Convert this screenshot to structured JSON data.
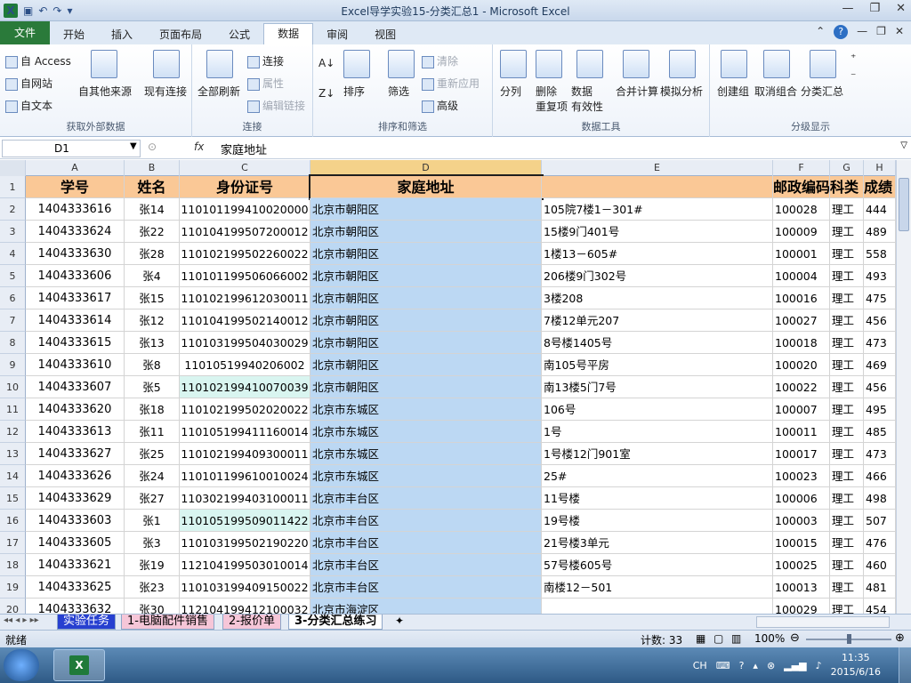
{
  "window": {
    "title": "Excel导学实验15-分类汇总1 - Microsoft Excel",
    "qat_icons": [
      "excel-icon",
      "save-icon",
      "undo-icon",
      "redo-icon",
      "customize-icon"
    ]
  },
  "ribbon": {
    "file_tab": "文件",
    "tabs": [
      "开始",
      "插入",
      "页面布局",
      "公式",
      "数据",
      "审阅",
      "视图"
    ],
    "active_tab": "数据",
    "groups": {
      "external": {
        "label": "获取外部数据",
        "access": "自 Access",
        "web": "自网站",
        "text": "自文本",
        "other": "自其他来源",
        "existing": "现有连接"
      },
      "connections": {
        "label": "连接",
        "refresh_all": "全部刷新",
        "connections": "连接",
        "properties": "属性",
        "edit_links": "编辑链接"
      },
      "sort_filter": {
        "label": "排序和筛选",
        "sort": "排序",
        "filter": "筛选",
        "clear": "清除",
        "reapply": "重新应用",
        "advanced": "高级"
      },
      "data_tools": {
        "label": "数据工具",
        "split": "分列",
        "remove_dup_1": "删除",
        "remove_dup_2": "重复项",
        "validation_1": "数据",
        "validation_2": "有效性",
        "consolidate": "合并计算",
        "whatif": "模拟分析"
      },
      "outline": {
        "label": "分级显示",
        "group": "创建组",
        "ungroup": "取消组合",
        "subtotal": "分类汇总"
      }
    }
  },
  "formula_bar": {
    "name_box": "D1",
    "fx": "fx",
    "content": "家庭地址"
  },
  "sheet": {
    "columns": [
      "A",
      "B",
      "C",
      "D",
      "E",
      "F",
      "G",
      "H"
    ],
    "headers": {
      "A": "学号",
      "B": "姓名",
      "C": "身份证号",
      "D": "家庭地址",
      "E": "",
      "F": "邮政编码",
      "G": "科类",
      "H": "成绩"
    },
    "rows": [
      {
        "n": "2",
        "a": "1404333616",
        "b": "张14",
        "c": "110101199410020000",
        "d": "北京市朝阳区",
        "e": "105院7楼1－301#",
        "f": "100028",
        "g": "理工",
        "h": "444"
      },
      {
        "n": "3",
        "a": "1404333624",
        "b": "张22",
        "c": "110104199507200012",
        "d": "北京市朝阳区",
        "e": "15楼9门401号",
        "f": "100009",
        "g": "理工",
        "h": "489"
      },
      {
        "n": "4",
        "a": "1404333630",
        "b": "张28",
        "c": "110102199502260022",
        "d": "北京市朝阳区",
        "e": "1楼13－605#",
        "f": "100001",
        "g": "理工",
        "h": "558"
      },
      {
        "n": "5",
        "a": "1404333606",
        "b": "张4",
        "c": "110101199506066002",
        "d": "北京市朝阳区",
        "e": "206楼9门302号",
        "f": "100004",
        "g": "理工",
        "h": "493"
      },
      {
        "n": "6",
        "a": "1404333617",
        "b": "张15",
        "c": "110102199612030011",
        "d": "北京市朝阳区",
        "e": "3楼208",
        "f": "100016",
        "g": "理工",
        "h": "475"
      },
      {
        "n": "7",
        "a": "1404333614",
        "b": "张12",
        "c": "110104199502140012",
        "d": "北京市朝阳区",
        "e": "7楼12单元207",
        "f": "100027",
        "g": "理工",
        "h": "456"
      },
      {
        "n": "8",
        "a": "1404333615",
        "b": "张13",
        "c": "110103199504030029",
        "d": "北京市朝阳区",
        "e": "8号楼1405号",
        "f": "100018",
        "g": "理工",
        "h": "473"
      },
      {
        "n": "9",
        "a": "1404333610",
        "b": "张8",
        "c": "11010519940206002",
        "d": "北京市朝阳区",
        "e": "南105号平房",
        "f": "100020",
        "g": "理工",
        "h": "469"
      },
      {
        "n": "10",
        "a": "1404333607",
        "b": "张5",
        "c": "110102199410070039",
        "d": "北京市朝阳区",
        "e": "南13楼5门7号",
        "f": "100022",
        "g": "理工",
        "h": "456"
      },
      {
        "n": "11",
        "a": "1404333620",
        "b": "张18",
        "c": "110102199502020022",
        "d": "北京市东城区",
        "e": "106号",
        "f": "100007",
        "g": "理工",
        "h": "495"
      },
      {
        "n": "12",
        "a": "1404333613",
        "b": "张11",
        "c": "110105199411160014",
        "d": "北京市东城区",
        "e": "1号",
        "f": "100011",
        "g": "理工",
        "h": "485"
      },
      {
        "n": "13",
        "a": "1404333627",
        "b": "张25",
        "c": "110102199409300011",
        "d": "北京市东城区",
        "e": "1号楼12门901室",
        "f": "100017",
        "g": "理工",
        "h": "473"
      },
      {
        "n": "14",
        "a": "1404333626",
        "b": "张24",
        "c": "110101199610010024",
        "d": "北京市东城区",
        "e": "25#",
        "f": "100023",
        "g": "理工",
        "h": "466"
      },
      {
        "n": "15",
        "a": "1404333629",
        "b": "张27",
        "c": "110302199403100011",
        "d": "北京市丰台区",
        "e": "11号楼",
        "f": "100006",
        "g": "理工",
        "h": "498"
      },
      {
        "n": "16",
        "a": "1404333603",
        "b": "张1",
        "c": "110105199509011422",
        "d": "北京市丰台区",
        "e": "19号楼",
        "f": "100003",
        "g": "理工",
        "h": "507"
      },
      {
        "n": "17",
        "a": "1404333605",
        "b": "张3",
        "c": "110103199502190220",
        "d": "北京市丰台区",
        "e": "21号楼3单元",
        "f": "100015",
        "g": "理工",
        "h": "476"
      },
      {
        "n": "18",
        "a": "1404333621",
        "b": "张19",
        "c": "112104199503010014",
        "d": "北京市丰台区",
        "e": "57号楼605号",
        "f": "100025",
        "g": "理工",
        "h": "460"
      },
      {
        "n": "19",
        "a": "1404333625",
        "b": "张23",
        "c": "110103199409150022",
        "d": "北京市丰台区",
        "e": "南楼12－501",
        "f": "100013",
        "g": "理工",
        "h": "481"
      },
      {
        "n": "20",
        "a": "1404333632",
        "b": "张30",
        "c": "112104199412100032",
        "d": "北京市海淀区",
        "e": "",
        "f": "100029",
        "g": "理工",
        "h": "454"
      }
    ]
  },
  "sheet_tabs": [
    "实验任务",
    "1-电脑配件销售",
    "2-报价单",
    "3-分类汇总练习"
  ],
  "active_sheet": "3-分类汇总练习",
  "status": {
    "mode": "就绪",
    "count": "计数: 33",
    "zoom": "100%"
  },
  "taskbar": {
    "lang": "CH",
    "time": "11:35",
    "date": "2015/6/16"
  },
  "colors": {
    "header_fill": "#fac896",
    "selected_column_fill": "#bcd8f3",
    "file_tab": "#2a7a3a"
  }
}
